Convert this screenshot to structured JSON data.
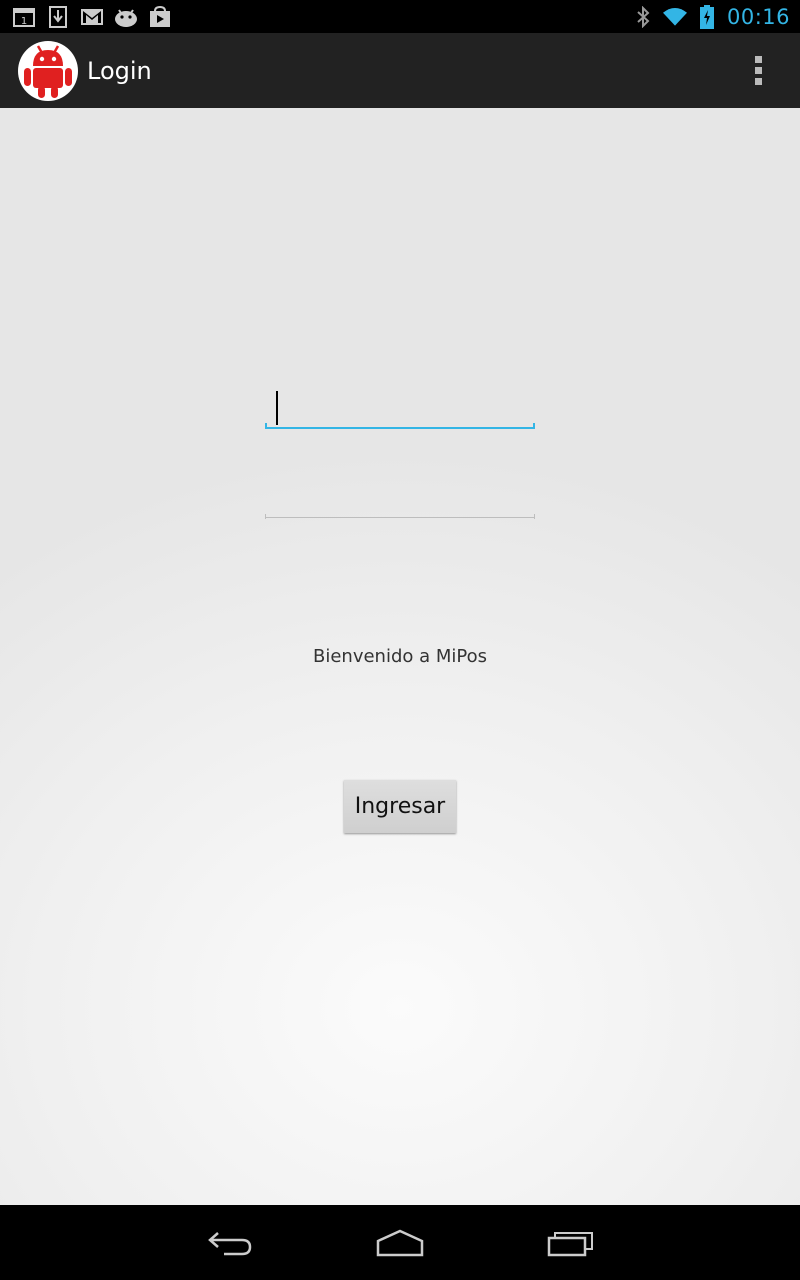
{
  "status_bar": {
    "time": "00:16",
    "notification_icons": [
      "calendar-icon",
      "download-icon",
      "gmail-icon",
      "android-icon",
      "play-store-icon"
    ],
    "system_icons": [
      "bluetooth-icon",
      "wifi-icon",
      "battery-charging-icon"
    ],
    "time_color": "#33b5e5"
  },
  "action_bar": {
    "title": "Login",
    "app_icon": "android-logo-icon",
    "menu_icon": "overflow-menu-icon",
    "background": "#222222"
  },
  "form": {
    "username_value": "",
    "password_value": "",
    "welcome_text": "Bienvenido a MiPos",
    "submit_label": "Ingresar",
    "focus_color": "#33b5e5"
  },
  "nav_bar": {
    "buttons": [
      "back-icon",
      "home-icon",
      "recents-icon"
    ]
  }
}
